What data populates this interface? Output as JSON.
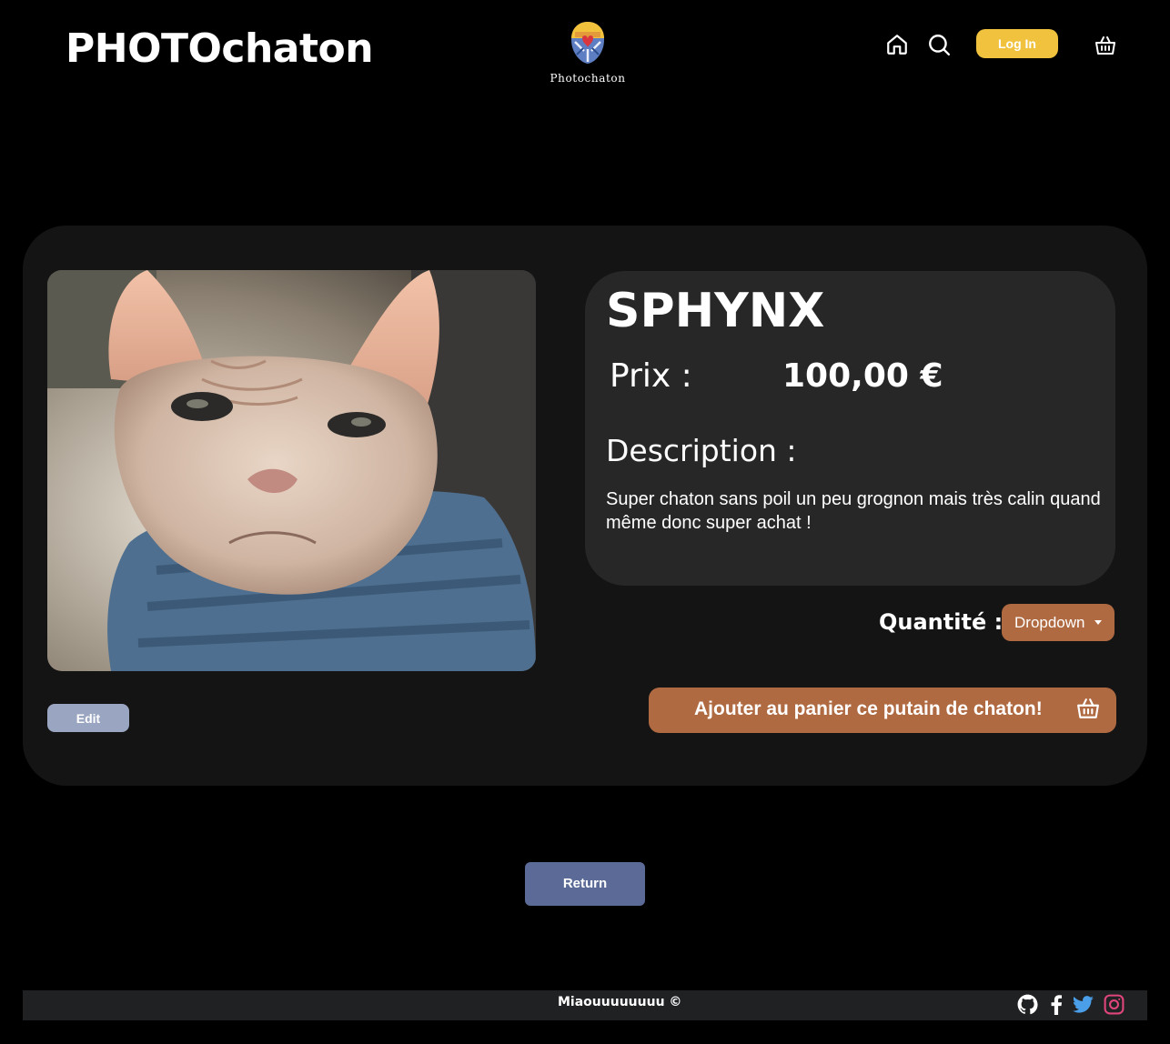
{
  "header": {
    "brand": "PHOTOchaton",
    "logo_caption": "Photochaton",
    "login_label": "Log In",
    "icons": [
      "home-icon",
      "search-icon",
      "basket-icon"
    ]
  },
  "product": {
    "name": "SPHYNX",
    "price_label": "Prix :",
    "price_value": "100,00 €",
    "description_label": "Description :",
    "description": "Super chaton sans poil un peu grognon mais très calin quand même donc super achat !",
    "quantity_label": "Quantité :",
    "quantity_dropdown": "Dropdown",
    "add_to_cart_label": "Ajouter au panier ce putain de chaton!",
    "edit_label": "Edit"
  },
  "return_label": "Return",
  "footer": {
    "text": "Miaouuuuuuuu ©",
    "social": [
      "github-icon",
      "facebook-icon",
      "twitter-icon",
      "instagram-icon"
    ]
  },
  "colors": {
    "accent_yellow": "#f0c23d",
    "accent_orange": "#b06a42",
    "return_blue": "#5b6a96",
    "edit_blue": "#9aa5c2",
    "twitter": "#4a9fe8",
    "instagram": "#e0457b"
  }
}
